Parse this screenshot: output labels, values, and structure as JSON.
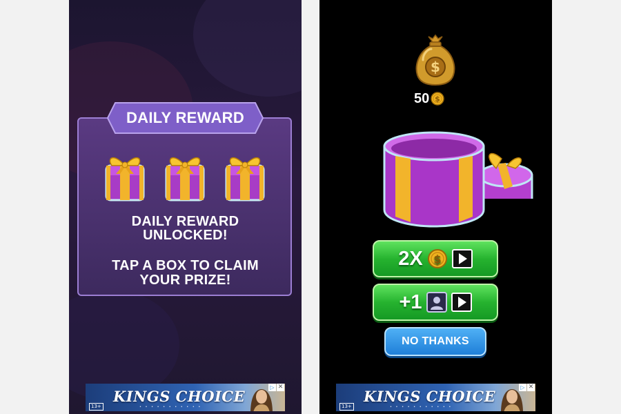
{
  "left_screen": {
    "banner_title": "DAILY REWARD",
    "message_line1": "DAILY REWARD",
    "message_line2": "UNLOCKED!",
    "message_line3": "TAP A BOX TO CLAIM",
    "message_line4": "YOUR PRIZE!",
    "gifts": [
      "gift-box",
      "gift-box",
      "gift-box"
    ]
  },
  "right_screen": {
    "coin_amount": "50",
    "double_button": {
      "label": "2X",
      "icons": [
        "coin-icon",
        "play-video-icon"
      ]
    },
    "plus_one_button": {
      "label": "+1",
      "icons": [
        "avatar-icon",
        "play-video-icon"
      ]
    },
    "no_thanks_button": "NO THANKS"
  },
  "ad_banner": {
    "title": "KINGS CHOICE",
    "age_rating": "13+",
    "adchoices_icon": "play-triangle-icon",
    "close_icon": "close-x-icon"
  },
  "colors": {
    "panel_purple": "#5a3a82",
    "banner_purple": "#7e5fc8",
    "gift_magenta": "#b44fd8",
    "ribbon_gold": "#f2b42b",
    "button_green": "#26b32f",
    "button_blue": "#1f7fd8",
    "coin_gold": "#f0b320"
  }
}
